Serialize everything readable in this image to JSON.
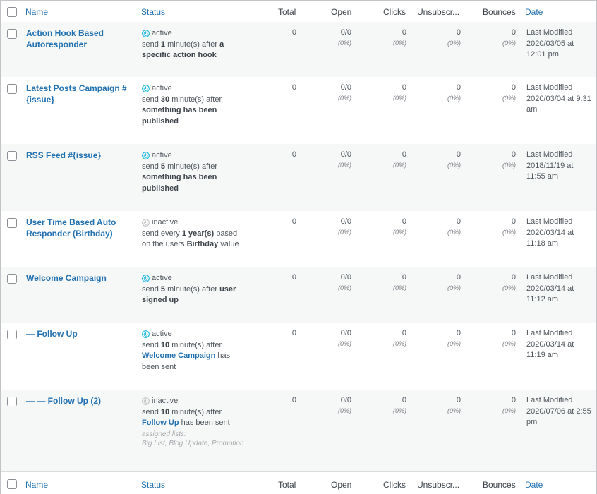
{
  "columns": {
    "name": "Name",
    "status": "Status",
    "total": "Total",
    "open": "Open",
    "clicks": "Clicks",
    "unsubscribes": "Unsubscr...",
    "bounces": "Bounces",
    "date": "Date"
  },
  "colors": {
    "link": "#2271b1",
    "active_icon": "#20b9e4",
    "inactive_icon": "#c3c4c7"
  },
  "rows": [
    {
      "name": "Action Hook Based Autoresponder",
      "status": "active",
      "desc": [
        [
          "send ",
          ""
        ],
        [
          "1",
          "b"
        ],
        [
          " minute(s) after ",
          ""
        ],
        [
          "a specific action hook",
          "b"
        ]
      ],
      "total": "0",
      "open": "0/0",
      "open_pct": "(0%)",
      "clicks": "0",
      "clicks_pct": "(0%)",
      "unsub": "0",
      "unsub_pct": "(0%)",
      "bounces": "0",
      "bounces_pct": "(0%)",
      "date": "Last Modified 2020/03/05 at 12:01 pm"
    },
    {
      "name": "Latest Posts Campaign #{issue}",
      "status": "active",
      "desc": [
        [
          "send ",
          ""
        ],
        [
          "30",
          "b"
        ],
        [
          " minute(s) after ",
          ""
        ],
        [
          "something has been published",
          "b"
        ]
      ],
      "total": "0",
      "open": "0/0",
      "open_pct": "(0%)",
      "clicks": "0",
      "clicks_pct": "(0%)",
      "unsub": "0",
      "unsub_pct": "(0%)",
      "bounces": "0",
      "bounces_pct": "(0%)",
      "date": "Last Modified 2020/03/04 at 9:31 am"
    },
    {
      "name": "RSS Feed #{issue}",
      "status": "active",
      "desc": [
        [
          "send ",
          ""
        ],
        [
          "5",
          "b"
        ],
        [
          " minute(s) after ",
          ""
        ],
        [
          "something has been published",
          "b"
        ]
      ],
      "total": "0",
      "open": "0/0",
      "open_pct": "(0%)",
      "clicks": "0",
      "clicks_pct": "(0%)",
      "unsub": "0",
      "unsub_pct": "(0%)",
      "bounces": "0",
      "bounces_pct": "(0%)",
      "date": "Last Modified 2018/11/19 at 11:55 am"
    },
    {
      "name": "User Time Based Auto Responder (Birthday)",
      "status": "inactive",
      "desc": [
        [
          "send every ",
          ""
        ],
        [
          "1 year(s)",
          "b"
        ],
        [
          " based on the users ",
          ""
        ],
        [
          "Birthday",
          "b"
        ],
        [
          " value",
          ""
        ]
      ],
      "total": "0",
      "open": "0/0",
      "open_pct": "(0%)",
      "clicks": "0",
      "clicks_pct": "(0%)",
      "unsub": "0",
      "unsub_pct": "(0%)",
      "bounces": "0",
      "bounces_pct": "(0%)",
      "date": "Last Modified 2020/03/14 at 11:18 am"
    },
    {
      "name": "Welcome Campaign",
      "status": "active",
      "desc": [
        [
          "send ",
          ""
        ],
        [
          "5",
          "b"
        ],
        [
          " minute(s) after ",
          ""
        ],
        [
          "user signed up",
          "b"
        ]
      ],
      "total": "0",
      "open": "0/0",
      "open_pct": "(0%)",
      "clicks": "0",
      "clicks_pct": "(0%)",
      "unsub": "0",
      "unsub_pct": "(0%)",
      "bounces": "0",
      "bounces_pct": "(0%)",
      "date": "Last Modified 2020/03/14 at 11:12 am"
    },
    {
      "name": "— Follow Up",
      "status": "active",
      "desc": [
        [
          "send ",
          ""
        ],
        [
          "10",
          "b"
        ],
        [
          " minute(s) after ",
          ""
        ],
        [
          "Welcome Campaign",
          "a"
        ],
        [
          " has been sent",
          ""
        ]
      ],
      "total": "0",
      "open": "0/0",
      "open_pct": "(0%)",
      "clicks": "0",
      "clicks_pct": "(0%)",
      "unsub": "0",
      "unsub_pct": "(0%)",
      "bounces": "0",
      "bounces_pct": "(0%)",
      "date": "Last Modified 2020/03/14 at 11:19 am"
    },
    {
      "name": "— — Follow Up (2)",
      "status": "inactive",
      "desc": [
        [
          "send ",
          ""
        ],
        [
          "10",
          "b"
        ],
        [
          " minute(s) after ",
          ""
        ],
        [
          "Follow Up",
          "a"
        ],
        [
          " has been sent",
          ""
        ]
      ],
      "lists_label": "assigned lists:",
      "lists": "Big List, Blog Update, Promotion",
      "total": "0",
      "open": "0/0",
      "open_pct": "(0%)",
      "clicks": "0",
      "clicks_pct": "(0%)",
      "unsub": "0",
      "unsub_pct": "(0%)",
      "bounces": "0",
      "bounces_pct": "(0%)",
      "date": "Last Modified 2020/07/06 at 2:55 pm"
    }
  ]
}
